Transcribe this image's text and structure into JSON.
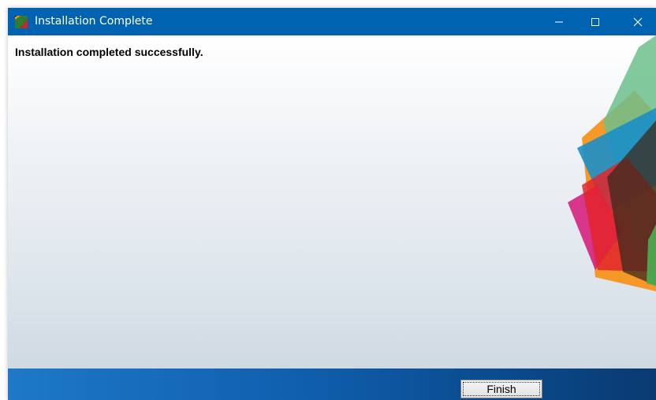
{
  "window": {
    "title": "Installation Complete",
    "icons": {
      "app": "installer-app-icon",
      "minimize": "minimize-icon",
      "maximize": "maximize-icon",
      "close": "close-icon"
    }
  },
  "content": {
    "message": "Installation completed successfully.",
    "decoration": "colorful-overlapping-shapes"
  },
  "footer": {
    "finish_label": "Finish"
  },
  "colors": {
    "titlebar": "#0063b1",
    "footer_light": "#1f78c8",
    "footer_dark": "#0a3a70",
    "accent_orange": "#f7941d",
    "accent_green": "#6cc08b",
    "accent_blue": "#1b8fc7",
    "accent_red": "#e0262b",
    "accent_magenta": "#d6217f"
  }
}
